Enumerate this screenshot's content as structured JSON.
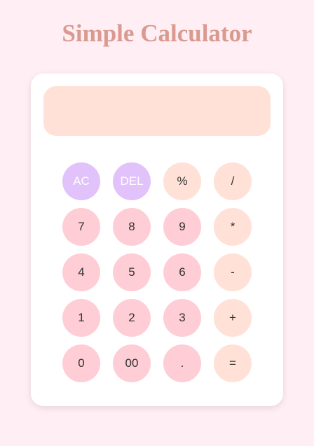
{
  "app": {
    "title": "Simple Calculator"
  },
  "display": {
    "value": ""
  },
  "keys": [
    {
      "label": "AC",
      "kind": "fn",
      "name": "clear-all-button"
    },
    {
      "label": "DEL",
      "kind": "fn",
      "name": "delete-button"
    },
    {
      "label": "%",
      "kind": "op",
      "name": "percent-button"
    },
    {
      "label": "/",
      "kind": "op",
      "name": "divide-button"
    },
    {
      "label": "7",
      "kind": "num",
      "name": "digit-7-button"
    },
    {
      "label": "8",
      "kind": "num",
      "name": "digit-8-button"
    },
    {
      "label": "9",
      "kind": "num",
      "name": "digit-9-button"
    },
    {
      "label": "*",
      "kind": "op",
      "name": "multiply-button"
    },
    {
      "label": "4",
      "kind": "num",
      "name": "digit-4-button"
    },
    {
      "label": "5",
      "kind": "num",
      "name": "digit-5-button"
    },
    {
      "label": "6",
      "kind": "num",
      "name": "digit-6-button"
    },
    {
      "label": "-",
      "kind": "op",
      "name": "subtract-button"
    },
    {
      "label": "1",
      "kind": "num",
      "name": "digit-1-button"
    },
    {
      "label": "2",
      "kind": "num",
      "name": "digit-2-button"
    },
    {
      "label": "3",
      "kind": "num",
      "name": "digit-3-button"
    },
    {
      "label": "+",
      "kind": "op",
      "name": "add-button"
    },
    {
      "label": "0",
      "kind": "num",
      "name": "digit-0-button"
    },
    {
      "label": "00",
      "kind": "num",
      "name": "double-zero-button"
    },
    {
      "label": ".",
      "kind": "num",
      "name": "decimal-point-button"
    },
    {
      "label": "=",
      "kind": "op",
      "name": "equals-button"
    }
  ],
  "colors": {
    "page_background": "#ffeef4",
    "title": "#d99a90",
    "display_background": "#ffe1d7",
    "function_key": "#e2c2fa",
    "operator_key": "#ffe1d7",
    "number_key": "#ffcdd6"
  }
}
